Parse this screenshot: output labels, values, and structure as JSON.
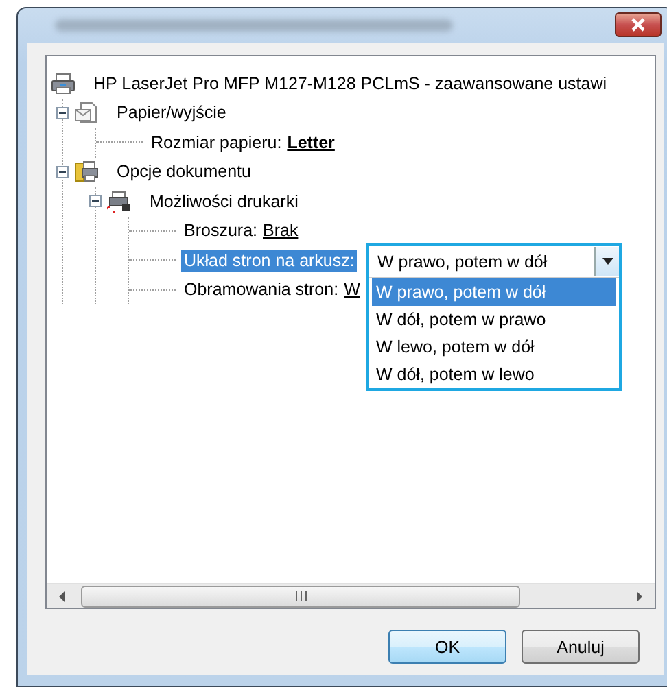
{
  "tree": [
    {
      "kind": "printer",
      "label": "HP LaserJet Pro MFP M127-M128 PCLmS - zaawansowane ustawi",
      "children": [
        {
          "kind": "paper",
          "label": "Papier/wyjście",
          "expanded": true,
          "children": [
            {
              "kind": "leaf",
              "label": "Rozmiar papieru:",
              "value": "Letter",
              "bold": true,
              "selected": false
            }
          ]
        },
        {
          "kind": "document",
          "label": "Opcje dokumentu",
          "expanded": true,
          "children": [
            {
              "kind": "features",
              "label": "Możliwości drukarki",
              "expanded": true,
              "children": [
                {
                  "kind": "leaf",
                  "label": "Broszura:",
                  "value": "Brak",
                  "bold": false,
                  "selected": false
                },
                {
                  "kind": "leaf",
                  "label": "Układ stron na arkusz:",
                  "selected": true,
                  "dropdown": {
                    "value": "W prawo, potem w dół",
                    "options": [
                      {
                        "label": "W prawo, potem w dół",
                        "selected": true
                      },
                      {
                        "label": "W dół, potem w prawo",
                        "selected": false
                      },
                      {
                        "label": "W lewo, potem w dół",
                        "selected": false
                      },
                      {
                        "label": "W dół, potem w lewo",
                        "selected": false
                      }
                    ]
                  }
                },
                {
                  "kind": "leaf",
                  "label": "Obramowania stron:",
                  "value": "W",
                  "bold": false,
                  "selected": false
                }
              ]
            }
          ]
        }
      ]
    }
  ],
  "buttons": [
    {
      "label": "OK",
      "default": true
    },
    {
      "label": "Anuluj",
      "default": false
    }
  ]
}
